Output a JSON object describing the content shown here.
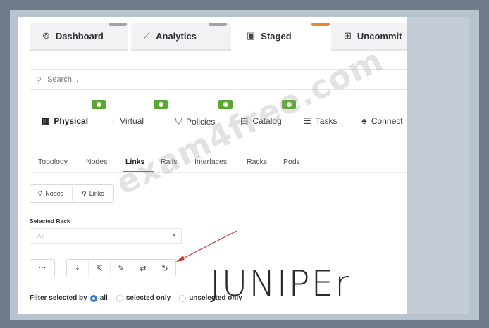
{
  "top_tabs": [
    {
      "label": "Dashboard",
      "icon": "dashboard-gauge-icon"
    },
    {
      "label": "Analytics",
      "icon": "analytics-chart-icon"
    },
    {
      "label": "Staged",
      "icon": "staged-document-icon"
    },
    {
      "label": "Uncommit",
      "icon": "uncommitted-icon"
    }
  ],
  "search": {
    "placeholder": "Search..."
  },
  "blueprint_tabs": [
    {
      "label": "Physical"
    },
    {
      "label": "Virtual"
    },
    {
      "label": "Policies"
    },
    {
      "label": "Catalog"
    },
    {
      "label": "Tasks"
    },
    {
      "label": "Connect"
    }
  ],
  "sub_nav": [
    "Topology",
    "Nodes",
    "Links",
    "Rails",
    "Interfaces",
    "Racks",
    "Pods"
  ],
  "query_buttons": {
    "nodes": "Nodes",
    "links": "Links"
  },
  "selected_rack": {
    "label": "Selected Rack",
    "value": "All"
  },
  "more_button": "···",
  "filter": {
    "label": "Filter selected by",
    "options": [
      "all",
      "selected only",
      "unselected only"
    ],
    "selected": "all"
  },
  "watermark": "exam4free.com",
  "logo": "JUNIPEr",
  "colors": {
    "badge": "#5aa832",
    "accent": "#2f7bd0",
    "arrow": "#c0392b",
    "staged_marker": "#f2822a"
  }
}
